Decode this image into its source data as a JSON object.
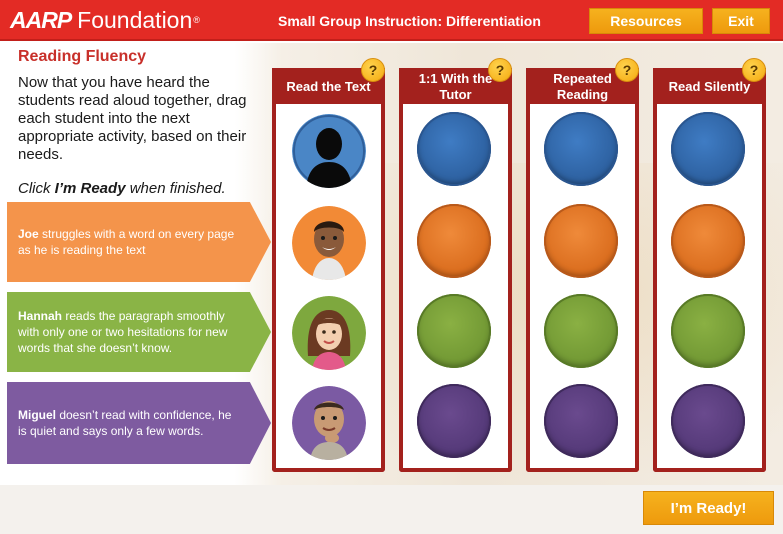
{
  "header": {
    "logo_brand": "AARP",
    "logo_word": "Foundation",
    "logo_reg": "®",
    "course_title": "Small Group Instruction: Differentiation",
    "resources_label": "Resources",
    "exit_label": "Exit"
  },
  "content": {
    "section_title": "Reading Fluency",
    "instructions": "Now that you have heard the students read aloud together, drag each student into the next appropriate activity, based on their needs.",
    "click_prefix": "Click ",
    "click_bold": "I’m Ready",
    "click_suffix": " when finished."
  },
  "students": [
    {
      "name": "Joe",
      "description": " struggles with a word on every page as he is reading the text",
      "color": "#f4944b"
    },
    {
      "name": "Hannah",
      "description": " reads the paragraph smoothly with only one or two hesitations for new words that she doesn’t know.",
      "color": "#8ab446"
    },
    {
      "name": "Miguel",
      "description": " doesn’t read with confidence, he is quiet and says only a few words.",
      "color": "#7e5ba0"
    }
  ],
  "columns": [
    {
      "label": "Read the Text",
      "help": "?"
    },
    {
      "label": "1:1 With the Tutor",
      "help": "?"
    },
    {
      "label": "Repeated Reading",
      "help": "?"
    },
    {
      "label": "Read Silently",
      "help": "?"
    }
  ],
  "colors": {
    "header_red": "#e32b25",
    "column_red": "#a3211d",
    "button_orange": "#f2a516",
    "slot_blue": "#2c5f9e",
    "slot_orange": "#d96b1c",
    "slot_green": "#709733",
    "slot_purple": "#533877"
  },
  "ready_label": "I’m Ready!"
}
